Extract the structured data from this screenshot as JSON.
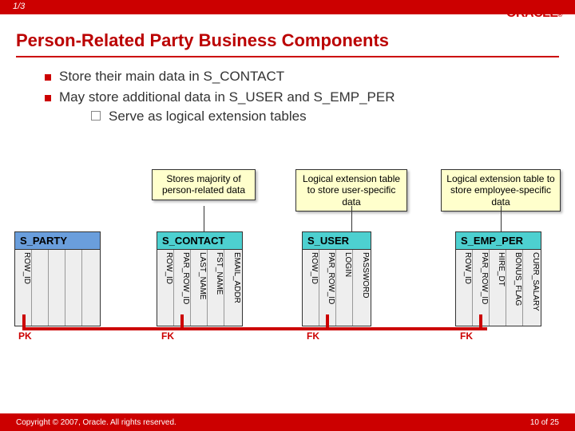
{
  "pager": "1/3",
  "logo": "ORACLE",
  "title": "Person-Related Party Business Components",
  "bullets": [
    "Store their main data in S_CONTACT",
    "May store additional data in S_USER and S_EMP_PER"
  ],
  "sub_bullet": "Serve as logical extension tables",
  "callouts": {
    "contact": "Stores majority of person-related data",
    "user": "Logical extension table to store user-specific data",
    "emp": "Logical extension table to store employee-specific data"
  },
  "tables": {
    "party": {
      "name": "S_PARTY",
      "cols": [
        "ROW_ID",
        "",
        "",
        "",
        ""
      ]
    },
    "contact": {
      "name": "S_CONTACT",
      "cols": [
        "ROW_ID",
        "PAR_ROW_ID",
        "LAST_NAME",
        "FST_NAME",
        "EMAIL_ADDR"
      ]
    },
    "user": {
      "name": "S_USER",
      "cols": [
        "ROW_ID",
        "PAR_ROW_ID",
        "LOGIN",
        "PASSWORD"
      ]
    },
    "emp": {
      "name": "S_EMP_PER",
      "cols": [
        "ROW_ID",
        "PAR_ROW_ID",
        "HIRE_DT",
        "BONUS_FLAG",
        "CURR_SALARY"
      ]
    }
  },
  "keys": {
    "pk": "PK",
    "fk": "FK"
  },
  "footer": {
    "copyright": "Copyright © 2007, Oracle. All rights reserved.",
    "page_prefix": "10",
    "page_of": " of ",
    "page_total": "25"
  }
}
